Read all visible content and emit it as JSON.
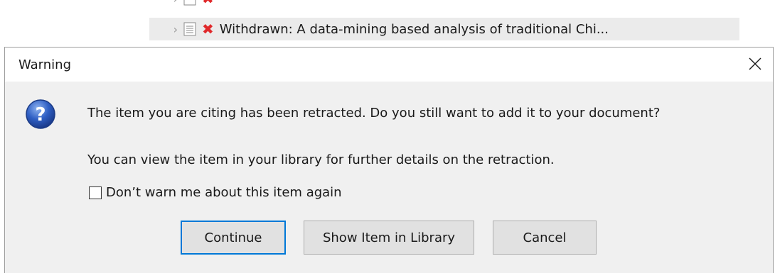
{
  "background": {
    "rows": [
      {
        "title": "Withdrawn: A data-mining based analysis of traditional Chi..."
      }
    ]
  },
  "dialog": {
    "title": "Warning",
    "message_primary": "The item you are citing has been retracted. Do you still want to add it to your document?",
    "message_secondary": "You can view the item in your library for further details on the retraction.",
    "checkbox_label": "Don’t warn me about this item again",
    "checkbox_checked": false,
    "buttons": {
      "continue": "Continue",
      "show_in_library": "Show Item in Library",
      "cancel": "Cancel"
    },
    "default_button": "continue"
  },
  "colors": {
    "accent": "#0078d7",
    "retracted_red": "#e0292b",
    "dialog_body": "#f0f0f0",
    "button_face": "#e1e1e1"
  },
  "icons": {
    "dialog_icon": "question-icon",
    "close": "close-icon",
    "retracted_marker": "retracted-x-icon",
    "document": "document-icon",
    "expand": "chevron-right-icon"
  }
}
